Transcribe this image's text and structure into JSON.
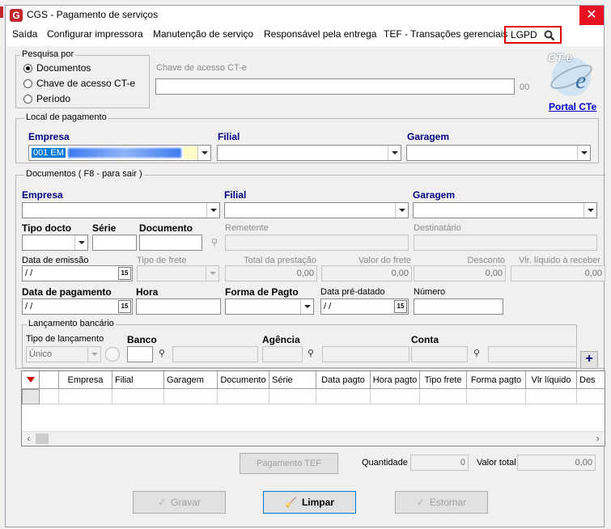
{
  "window": {
    "title": "CGS - Pagamento de serviços",
    "close_glyph": "✕"
  },
  "menu": {
    "items": [
      "Saída",
      "Configurar impressora",
      "Manutenção de serviço",
      "Responsável pela entrega",
      "TEF - Transações gerenciais",
      "LGPD"
    ]
  },
  "pesquisa": {
    "title": "Pesquisa por",
    "options": [
      "Documentos",
      "Chave de acesso CT-e",
      "Período"
    ],
    "selected": "Documentos",
    "chave_label": "Chave de acesso CT-e",
    "chave_value": "",
    "chave_suffix": "00"
  },
  "portal": {
    "logo_text": "CT-e",
    "link": "Portal CTe"
  },
  "local": {
    "title": "Local de pagamento",
    "empresa_label": "Empresa",
    "empresa_value": "001 EM",
    "filial_label": "Filial",
    "garagem_label": "Garagem"
  },
  "documentos": {
    "title": "Documentos ( F8 - para sair )",
    "empresa_label": "Empresa",
    "filial_label": "Filial",
    "garagem_label": "Garagem",
    "tipo_docto_label": "Tipo docto",
    "serie_label": "Série",
    "documento_label": "Documento",
    "remetente_label": "Remetente",
    "destinatario_label": "Destinatário",
    "data_emissao_label": "Data de emissão",
    "data_emissao_value": " / /",
    "tipo_frete_label": "Tipo de frete",
    "total_prestacao_label": "Total da prestação",
    "total_prestacao_value": "0,00",
    "valor_frete_label": "Valor do frete",
    "valor_frete_value": "0,00",
    "desconto_label": "Desconto",
    "desconto_value": "0,00",
    "liquido_label": "Vlr. líquido à receber",
    "liquido_value": "0,00",
    "data_pagamento_label": "Data de pagamento",
    "data_pagamento_value": " / /",
    "hora_label": "Hora",
    "forma_pagto_label": "Forma de Pagto",
    "data_predatado_label": "Data pré-datado",
    "data_predatado_value": " / /",
    "numero_label": "Número",
    "cal_glyph": "15"
  },
  "lancamento": {
    "title": "Lançamento bancário",
    "tipo_label": "Tipo de lançamento",
    "tipo_value": "Único",
    "banco_label": "Banco",
    "agencia_label": "Agência",
    "conta_label": "Conta",
    "add_glyph": "+"
  },
  "grid": {
    "columns": [
      "Empresa",
      "Filial",
      "Garagem",
      "Documento",
      "Série",
      "Data pagto",
      "Hora pagto",
      "Tipo frete",
      "Forma pagto",
      "Vlr líquido",
      "Des"
    ]
  },
  "footer": {
    "pagamento_tef": "Pagamento TEF",
    "quantidade_label": "Quantidade",
    "quantidade_value": "0",
    "valor_total_label": "Valor total",
    "valor_total_value": "0,00",
    "gravar": "Gravar",
    "limpar": "Limpar",
    "estornar": "Estornar"
  },
  "colors": {
    "accent_blue": "#000080",
    "lgpd_border": "#e00000",
    "close_red": "#e81123",
    "link_blue": "#0000cc"
  }
}
